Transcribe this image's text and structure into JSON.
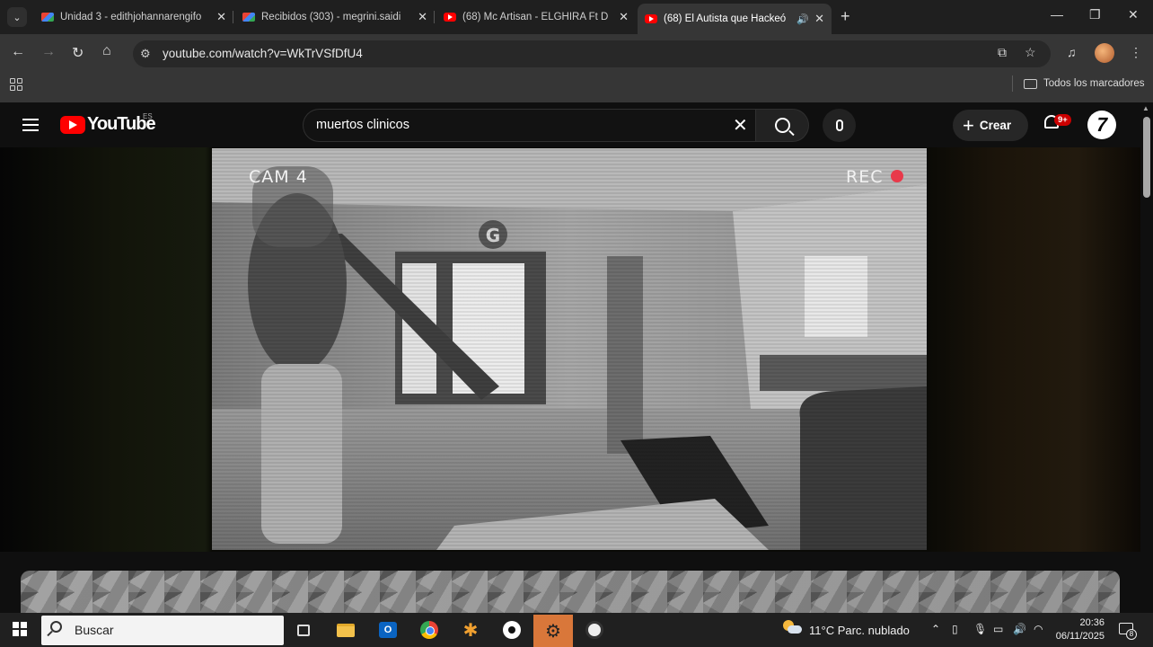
{
  "browser": {
    "tabs": [
      {
        "title": "Unidad 3 - edithjohannarengifo",
        "favicon": "gmail-icon",
        "active": false
      },
      {
        "title": "Recibidos (303) - megrini.saidi",
        "favicon": "gmail-icon",
        "active": false
      },
      {
        "title": "(68) Mc Artisan - ELGHIRA Ft D",
        "favicon": "youtube-icon",
        "active": false
      },
      {
        "title": "(68) El Autista que Hackeó",
        "favicon": "youtube-icon",
        "active": true,
        "audio": true
      }
    ],
    "url": "youtube.com/watch?v=WkTrVSfDfU4",
    "bookmarks_label": "Todos los marcadores"
  },
  "youtube": {
    "logo_text": "YouTube",
    "region": "ES",
    "search_query": "muertos clinicos",
    "create_label": "Crear",
    "notifications_badge": "9+",
    "avatar_glyph": "7"
  },
  "video": {
    "cam_label": "CAM 4",
    "rec_label": "REC"
  },
  "taskbar": {
    "search_placeholder": "Buscar",
    "weather": "11°C  Parc. nublado",
    "time": "20:36",
    "date": "06/11/2025",
    "notification_count": "8"
  },
  "colors": {
    "brand_red": "#ff0000",
    "rec_dot": "#e8394a",
    "badge_red": "#cc0000",
    "active_taskbar_app": "#d9773a"
  }
}
